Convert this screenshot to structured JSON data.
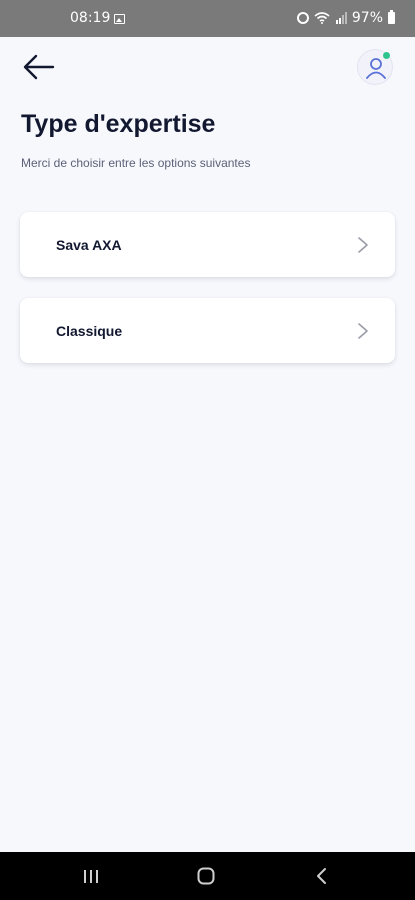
{
  "status_bar": {
    "time": "08:19",
    "battery": "97%",
    "icons": [
      "image-icon",
      "alarm-icon",
      "wifi-icon",
      "signal-icon",
      "battery-icon"
    ]
  },
  "header": {
    "back_icon": "arrow-left-icon",
    "avatar_icon": "user-icon",
    "online_color": "#2fc48d"
  },
  "page": {
    "title": "Type d'expertise",
    "subtitle": "Merci de choisir entre les options suivantes"
  },
  "options": [
    {
      "label": "Sava AXA",
      "icon": "chevron-right-icon"
    },
    {
      "label": "Classique",
      "icon": "chevron-right-icon"
    }
  ],
  "nav_bar": {
    "items": [
      "recents-icon",
      "home-icon",
      "back-icon"
    ]
  },
  "colors": {
    "background": "#f7f8fc",
    "title": "#121830",
    "subtitle": "#5c6178",
    "status_bar": "#7a7a7a"
  }
}
